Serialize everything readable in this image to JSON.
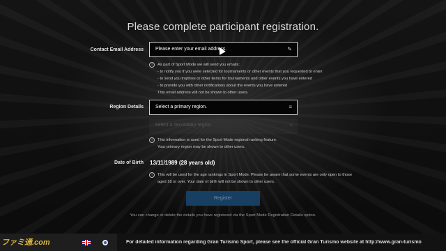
{
  "page": {
    "title": "Please complete participant registration."
  },
  "contact": {
    "label": "Contact Email Address",
    "value": "Please enter your email address.",
    "icon": "pencil-icon",
    "info_lines": [
      "As part of Sport Mode we will send you emails:",
      "- to notify you if you were selected for tournaments or other events that you requested to enter",
      "- to send you trophies or other items for tournaments and other events you have entered",
      "- to provide you with other notifications about the events you have entered",
      "This email address will not be shown to other users."
    ]
  },
  "region": {
    "label": "Region Details",
    "primary_value": "Select a primary region.",
    "secondary_value": "Select a secondary region.",
    "icon": "list-icon",
    "info_lines": [
      "This information is used for the Sport Mode regional ranking feature.",
      "Your primary region may be shown to other users."
    ]
  },
  "dob": {
    "label": "Date of Birth",
    "value": "13/11/1989 (28 years old)",
    "info_lines": [
      "This will be used for the age rankings in Sport Mode. Please be aware that some events are only open to those",
      "aged 18 or over. Your date of birth will not be shown to other users."
    ]
  },
  "register_button": {
    "label": "Register"
  },
  "footnote": "You can change or delete the details you have registered via the Sport Mode Registration Details option.",
  "bottom_bar": {
    "logo_text": "ファミ通.com",
    "ticker": "For detailed information regarding Gran Turismo Sport, please see the official Gran Turismo website at http://www.gran-turismo"
  }
}
